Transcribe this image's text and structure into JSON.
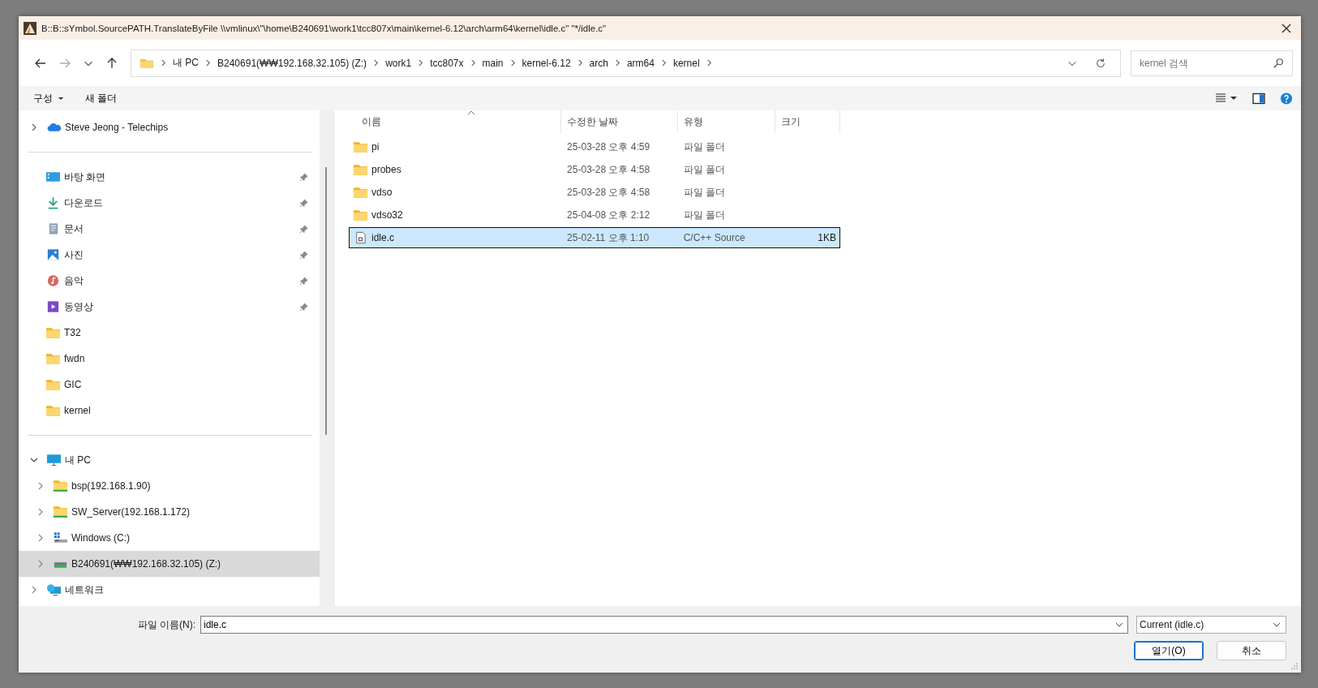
{
  "window": {
    "title": "B::B::sYmbol.SourcePATH.TranslateByFile \\\\vmlinux\\\"\\home\\B240691\\work1\\tcc807x\\main\\kernel-6.12\\arch\\arm64\\kernel\\idle.c\" \"*/idle.c\""
  },
  "address_bar": {
    "breadcrumb": [
      "내 PC",
      "B240691(₩₩192.168.32.105) (Z:)",
      "work1",
      "tcc807x",
      "main",
      "kernel-6.12",
      "arch",
      "arm64",
      "kernel"
    ]
  },
  "search": {
    "placeholder": "kernel 검색"
  },
  "toolbar": {
    "organize": "구성",
    "new_folder": "새 폴더"
  },
  "sidebar": {
    "account": {
      "label": "Steve Jeong - Telechips",
      "kind": "cloud",
      "expanded": false
    },
    "quick_access": [
      {
        "label": "바탕 화면",
        "kind": "desktop",
        "pinned": true
      },
      {
        "label": "다운로드",
        "kind": "download",
        "pinned": true
      },
      {
        "label": "문서",
        "kind": "documents",
        "pinned": true
      },
      {
        "label": "사진",
        "kind": "pictures",
        "pinned": true
      },
      {
        "label": "음악",
        "kind": "music",
        "pinned": true
      },
      {
        "label": "동영상",
        "kind": "video",
        "pinned": true
      },
      {
        "label": "T32",
        "kind": "folder",
        "pinned": false
      },
      {
        "label": "fwdn",
        "kind": "folder",
        "pinned": false
      },
      {
        "label": "GIC",
        "kind": "folder",
        "pinned": false
      },
      {
        "label": "kernel",
        "kind": "folder",
        "pinned": false
      }
    ],
    "tree": [
      {
        "label": "내 PC",
        "kind": "pc",
        "expanded": true,
        "selected": false,
        "children": [
          {
            "label": "bsp(192.168.1.90)",
            "kind": "share",
            "expanded": false,
            "selected": false
          },
          {
            "label": "SW_Server(192.168.1.172)",
            "kind": "share",
            "expanded": false,
            "selected": false
          },
          {
            "label": "Windows (C:)",
            "kind": "windows-drive",
            "expanded": false,
            "selected": false
          },
          {
            "label": "B240691(₩₩192.168.32.105) (Z:)",
            "kind": "network-drive",
            "expanded": false,
            "selected": true
          }
        ]
      },
      {
        "label": "네트워크",
        "kind": "network",
        "expanded": false,
        "selected": false
      }
    ]
  },
  "table": {
    "columns": [
      "이름",
      "수정한 날짜",
      "유형",
      "크기"
    ],
    "rows": [
      {
        "name": "pi",
        "kind": "folder",
        "modified": "25-03-28 오후 4:59",
        "type": "파일 폴더",
        "selected": false
      },
      {
        "name": "probes",
        "kind": "folder",
        "modified": "25-03-28 오후 4:58",
        "type": "파일 폴더",
        "selected": false
      },
      {
        "name": "vdso",
        "kind": "folder",
        "modified": "25-03-28 오후 4:58",
        "type": "파일 폴더",
        "selected": false
      },
      {
        "name": "vdso32",
        "kind": "folder",
        "modified": "25-04-08 오후 2:12",
        "type": "파일 폴더",
        "selected": false
      },
      {
        "name": "idle.c",
        "kind": "source",
        "modified": "25-02-11 오후 1:10",
        "type": "C/C++ Source",
        "size": "1KB",
        "selected": true
      }
    ]
  },
  "footer": {
    "file_name_label": "파일 이름(N):",
    "file_name": "idle.c",
    "filter": "Current (idle.c)",
    "open": "열기(O)",
    "cancel": "취소"
  }
}
